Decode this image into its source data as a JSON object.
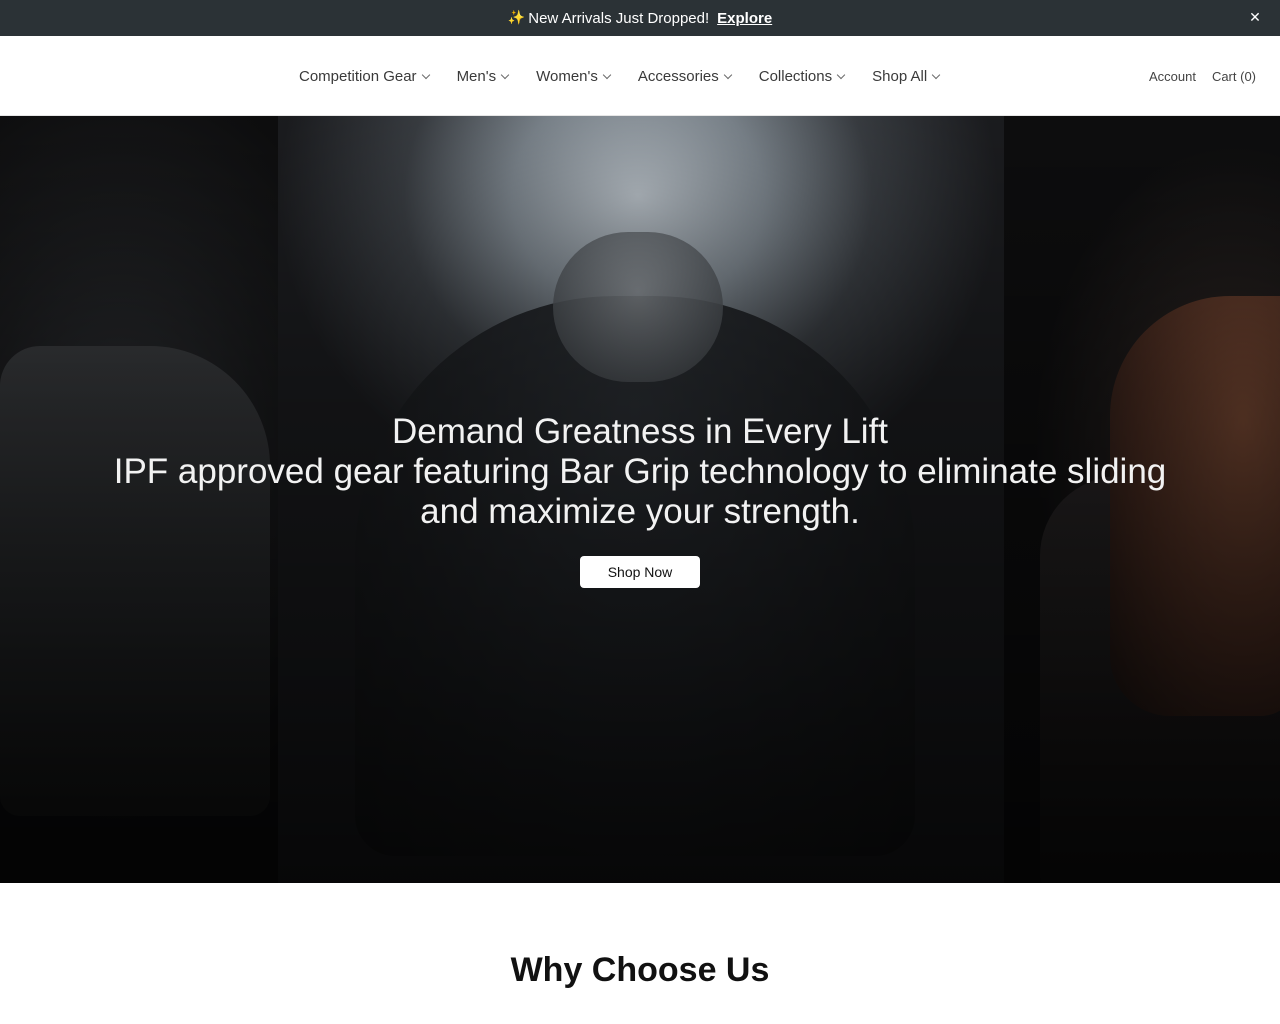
{
  "announcement": {
    "icon": "sparkles-icon",
    "message": "New Arrivals Just Dropped!",
    "link_label": "Explore",
    "close_glyph": "✕"
  },
  "nav": {
    "items": [
      {
        "label": "Competition Gear"
      },
      {
        "label": "Men's"
      },
      {
        "label": "Women's"
      },
      {
        "label": "Accessories"
      },
      {
        "label": "Collections"
      },
      {
        "label": "Shop All"
      }
    ]
  },
  "utilities": {
    "account_label": "Account",
    "cart_label": "Cart (0)"
  },
  "hero": {
    "title": "Demand Greatness in Every Lift",
    "subtitle": "IPF approved gear featuring Bar Grip technology to eliminate sliding and maximize your strength.",
    "button_label": "Shop Now"
  },
  "why": {
    "title": "Why Choose Us"
  },
  "colors": {
    "announcement_bg": "#2b3236",
    "hero_text": "#f2f2f2",
    "button_bg": "#ffffff"
  }
}
